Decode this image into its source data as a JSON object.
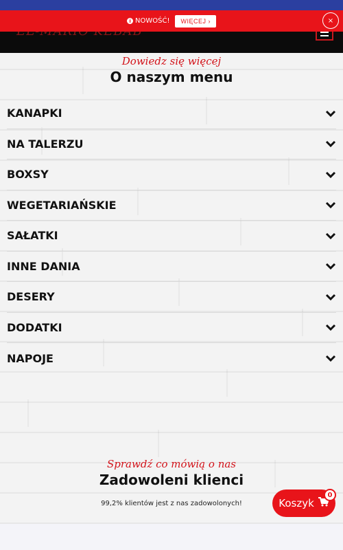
{
  "header": {
    "logo_text": "EL-MARIO KEBAB",
    "menu_icon": "hamburger-icon"
  },
  "notice": {
    "icon": "info-icon",
    "text": "NOWOŚĆ!",
    "button_label": "WIĘCEJ ›",
    "close_label": "×"
  },
  "menu_section": {
    "script_title": "Dowiedz się więcej",
    "title": "O naszym menu",
    "items": [
      {
        "label": "KANAPKI"
      },
      {
        "label": "NA TALERZU"
      },
      {
        "label": "BOXSY"
      },
      {
        "label": "WEGETARIAŃSKIE"
      },
      {
        "label": "SAŁATKI"
      },
      {
        "label": "INNE DANIA"
      },
      {
        "label": "DESERY"
      },
      {
        "label": "DODATKI"
      },
      {
        "label": "NAPOJE"
      }
    ],
    "item_icon": "chevron-down-icon"
  },
  "reviews_section": {
    "script_title": "Sprawdź co mówią o nas",
    "title": "Zadowoleni klienci",
    "subtitle": "99,2% klientów jest z nas zadowolonych!"
  },
  "cart": {
    "label": "Koszyk",
    "icon": "cart-icon",
    "count": "0"
  },
  "colors": {
    "accent": "#e8141a",
    "header_bg": "#0b0b0b",
    "top_strip": "#2b3fa0",
    "text": "#111111"
  }
}
